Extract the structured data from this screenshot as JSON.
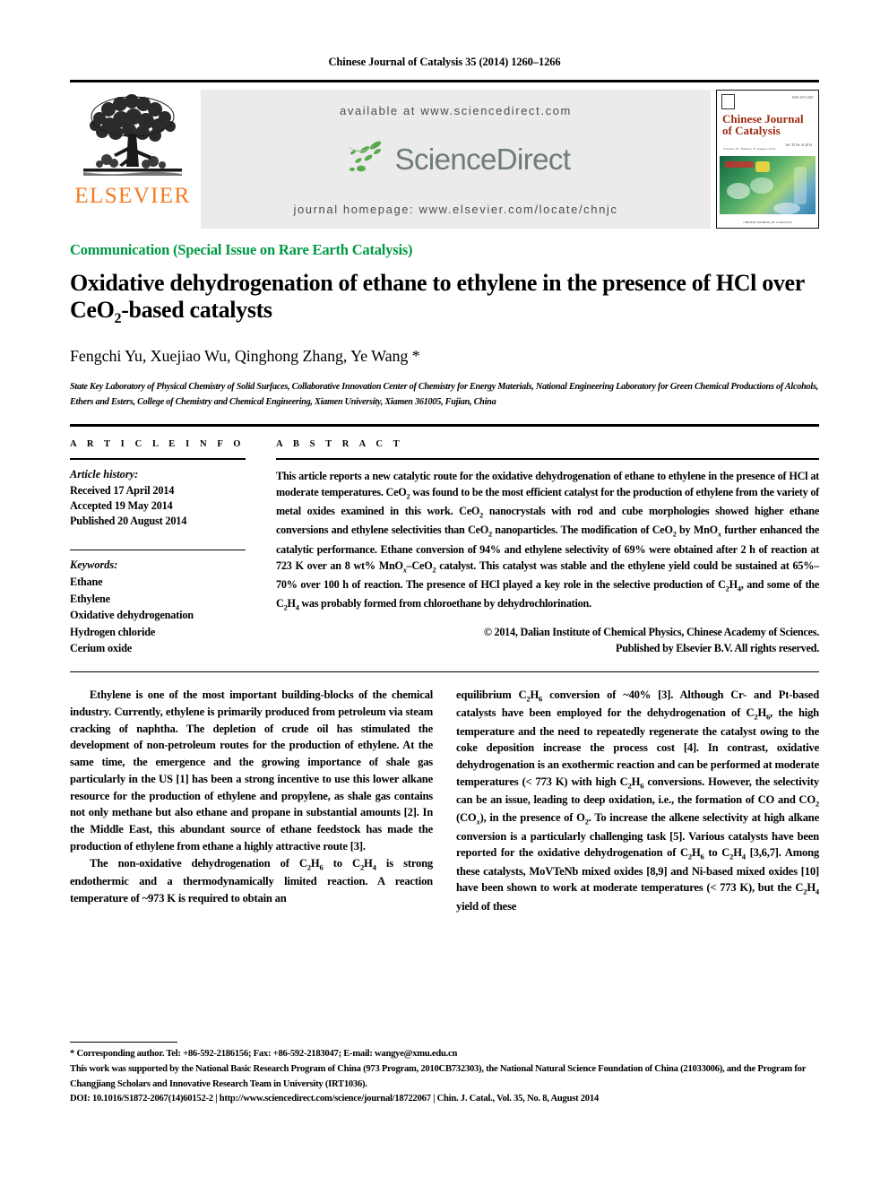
{
  "running_head": "Chinese Journal of Catalysis 35 (2014) 1260–1266",
  "publisher": {
    "name": "ELSEVIER",
    "logo_icon": "elsevier-tree-icon",
    "brand_color": "#F47920"
  },
  "sciencedirect_banner": {
    "available_at": "available at www.sciencedirect.com",
    "wordmark": "ScienceDirect",
    "leaf_icon": "sciencedirect-leaf-icon",
    "journal_homepage": "journal homepage: www.elsevier.com/locate/chnjc",
    "background_color": "#EBEBEB",
    "wordmark_color": "#6D7B7B"
  },
  "journal_cover": {
    "title_line1": "Chinese Journal",
    "title_line2": "of Catalysis",
    "title_color": "#9E2A12",
    "publisher_logo_icon": "elsevier-mini-logo-icon",
    "top_right_note": "ISSN 1872-2067",
    "sub_note": "Volume 35, Number 8, August 2014",
    "volume_note": "Vol. 35\nNo. 8, 2014",
    "footer_note": "CHINESE JOURNAL OF CATALYSIS"
  },
  "article_type": "Communication (Special Issue on Rare Earth Catalysis)",
  "article_type_color": "#009944",
  "title": {
    "part1": "Oxidative dehydrogenation of ethane to ethylene in the presence of HCl over CeO",
    "sub": "2",
    "part2": "-based catalysts"
  },
  "authors": "Fengchi Yu, Xuejiao Wu, Qinghong Zhang, Ye Wang *",
  "affiliation": "State Key Laboratory of Physical Chemistry of Solid Surfaces, Collaborative Innovation Center of Chemistry for Energy Materials, National Engineering Laboratory for Green Chemical Productions of Alcohols, Ethers and Esters, College of Chemistry and Chemical Engineering, Xiamen University, Xiamen 361005, Fujian, China",
  "article_info": {
    "heading": "A R T I C L E   I N F O",
    "history_label": "Article history:",
    "history": [
      "Received 17 April 2014",
      "Accepted 19 May 2014",
      "Published 20 August 2014"
    ],
    "keywords_label": "Keywords:",
    "keywords": [
      "Ethane",
      "Ethylene",
      "Oxidative dehydrogenation",
      "Hydrogen chloride",
      "Cerium oxide"
    ]
  },
  "abstract": {
    "heading": "A B S T R A C T",
    "body_html": "This article reports a new catalytic route for the oxidative dehydrogenation of ethane to ethylene in the presence of HCl at moderate temperatures. CeO<sub>2</sub> was found to be the most efficient catalyst for the production of ethylene from the variety of metal oxides examined in this work. CeO<sub>2</sub> nanocrystals with rod and cube morphologies showed higher ethane conversions and ethylene selectivities than CeO<sub>2</sub> nanoparticles. The modification of CeO<sub>2</sub> by MnO<i><sub>x</sub></i> further enhanced the catalytic performance. Ethane conversion of 94% and ethylene selectivity of 69% were obtained after 2 h of reaction at 723 K over an 8 wt% MnO<i><sub>x</sub></i>–CeO<sub>2</sub> catalyst. This catalyst was stable and the ethylene yield could be sustained at 65%–70% over 100 h of reaction. The presence of HCl played a key role in the selective production of C<sub>2</sub>H<sub>4</sub>, and some of the C<sub>2</sub>H<sub>4</sub> was probably formed from chloroethane by dehydrochlorination.",
    "copyright_line1": "© 2014, Dalian Institute of Chemical Physics, Chinese Academy of Sciences.",
    "copyright_line2": "Published by Elsevier B.V. All rights reserved."
  },
  "body": {
    "left_column": [
      "Ethylene is one of the most important building-blocks of the chemical industry. Currently, ethylene is primarily produced from petroleum via steam cracking of naphtha. The depletion of crude oil has stimulated the development of non-petroleum routes for the production of ethylene. At the same time, the emergence and the growing importance of shale gas particularly in the US [1] has been a strong incentive to use this lower alkane resource for the production of ethylene and propylene, as shale gas contains not only methane but also ethane and propane in substantial amounts [2]. In the Middle East, this abundant source of ethane feedstock has made the production of ethylene from ethane a highly attractive route [3]."
    ],
    "left_column_html": [
      "The non-oxidative dehydrogenation of C<sub>2</sub>H<sub>6</sub> to C<sub>2</sub>H<sub>4</sub> is strong endothermic and a thermodynamically limited reaction. A reaction temperature of ~973 K is required to obtain an"
    ],
    "right_column_html": [
      "equilibrium C<sub>2</sub>H<sub>6</sub> conversion of ~40% [3]. Although Cr- and Pt-based catalysts have been employed for the dehydrogenation of C<sub>2</sub>H<sub>6</sub>, the high temperature and the need to repeatedly regenerate the catalyst owing to the coke deposition increase the process cost [4]. In contrast, oxidative dehydrogenation is an exothermic reaction and can be performed at moderate temperatures (&lt; 773 K) with high C<sub>2</sub>H<sub>6</sub> conversions. However, the selectivity can be an issue, leading to deep oxidation, i.e., the formation of CO and CO<sub>2</sub> (CO<i><sub>x</sub></i>), in the presence of O<sub>2</sub>. To increase the alkene selectivity at high alkane conversion is a particularly challenging task [5]. Various catalysts have been reported for the oxidative dehydrogenation of C<sub>2</sub>H<sub>6</sub> to C<sub>2</sub>H<sub>4</sub> [3,6,7]. Among these catalysts, MoVTeNb mixed oxides [8,9] and Ni-based mixed oxides [10] have been shown to work at moderate temperatures (&lt; 773 K), but the C<sub>2</sub>H<sub>4</sub> yield of these"
    ]
  },
  "footer": {
    "corresponding": "* Corresponding author. Tel: +86-592-2186156; Fax: +86-592-2183047; E-mail: wangye@xmu.edu.cn",
    "funding": "This work was supported by the National Basic Research Program of China (973 Program, 2010CB732303), the National Natural Science Foundation of China (21033006), and the Program for Changjiang Scholars and Innovative Research Team in University (IRT1036).",
    "doi_line": "DOI: 10.1016/S1872-2067(14)60152-2 | http://www.sciencedirect.com/science/journal/18722067 | Chin. J. Catal., Vol. 35, No. 8, August 2014"
  }
}
